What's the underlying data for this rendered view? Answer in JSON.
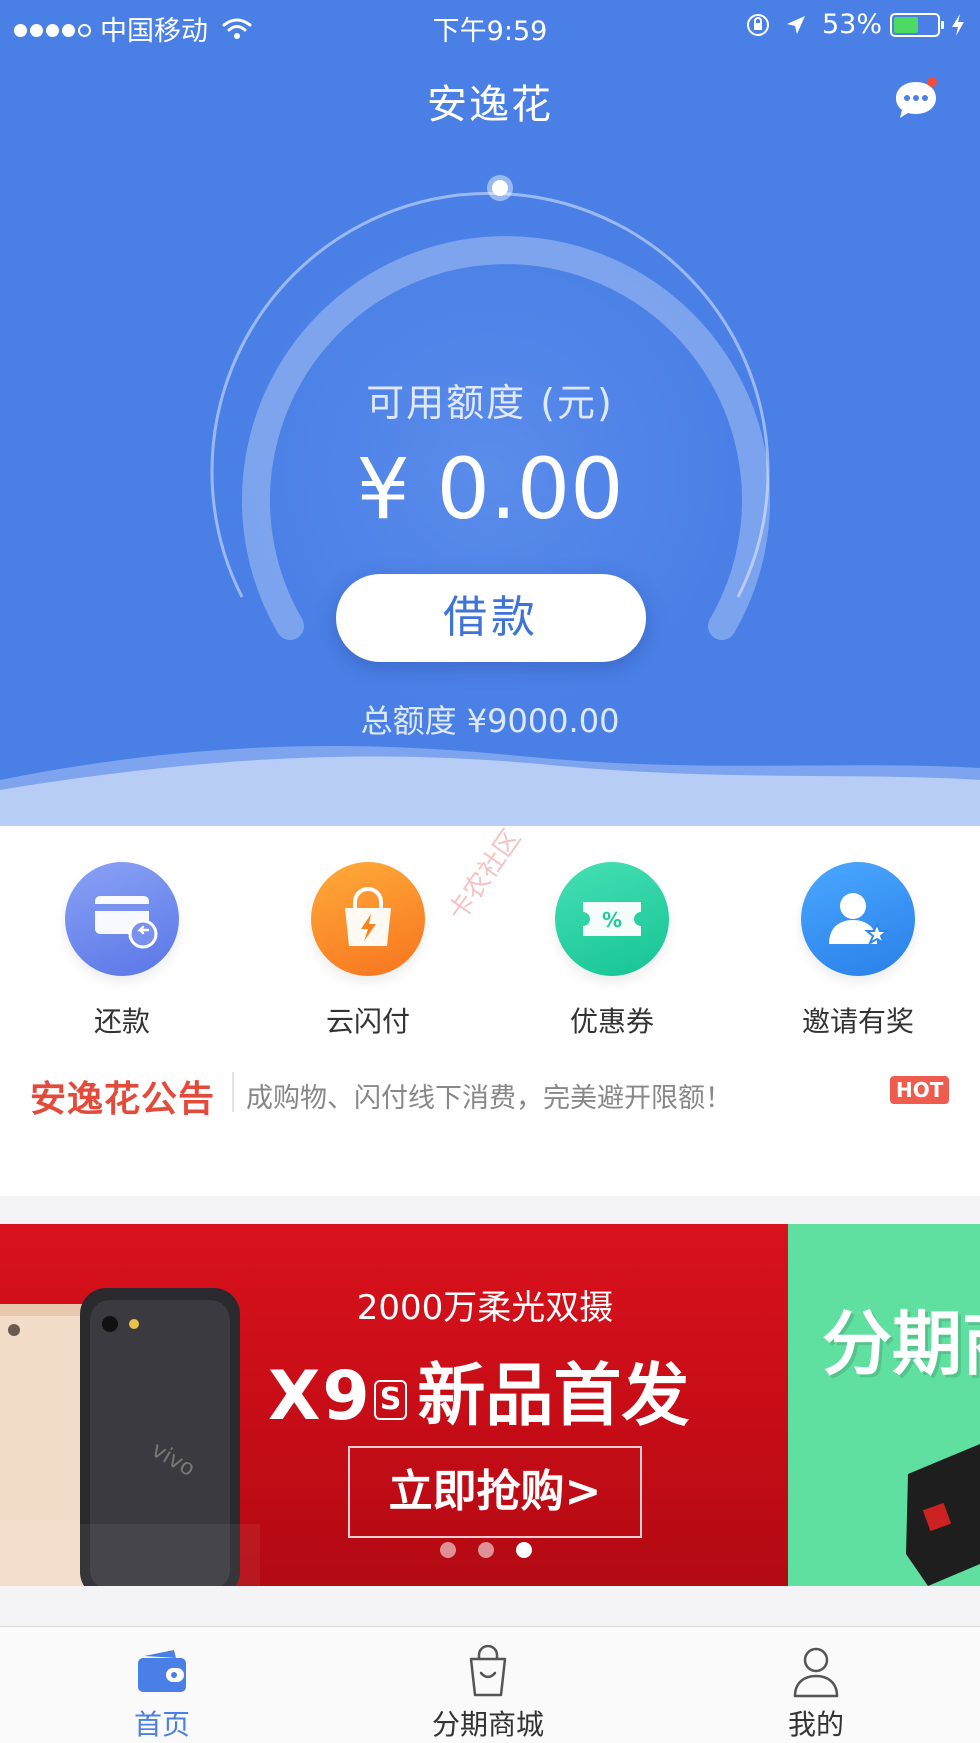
{
  "status_bar": {
    "carrier": "中国移动",
    "time": "下午9:59",
    "battery": "53%"
  },
  "header": {
    "title": "安逸花",
    "message_icon": "chat-bubble-icon"
  },
  "credit": {
    "available_label": "可用额度 (元)",
    "available_amount": "¥ 0.00",
    "loan_button": "借款",
    "total_label": "总额度 ¥9000.00",
    "usage_fraction": 0.0
  },
  "shortcuts": [
    {
      "label": "还款",
      "icon": "repay-card-icon",
      "color": "#6b86ef"
    },
    {
      "label": "云闪付",
      "icon": "shopping-bag-icon",
      "color": "#fb8f2a"
    },
    {
      "label": "优惠券",
      "icon": "coupon-icon",
      "color": "#27d3a2"
    },
    {
      "label": "邀请有奖",
      "icon": "invite-user-icon",
      "color": "#3c93f5"
    }
  ],
  "watermark": "卡农社区",
  "notice": {
    "title": "安逸花公告",
    "text": "成购物、闪付线下消费，完美避开限额！",
    "badge": "HOT"
  },
  "banner": {
    "subtitle": "2000万柔光双摄",
    "model": "X9",
    "model_suffix": "S",
    "headline": "新品首发",
    "cta": "立即抢购>",
    "brand": "vivo",
    "next_slide_text": "分期商",
    "active_dot": 2
  },
  "tabbar": [
    {
      "label": "首页",
      "icon": "wallet-icon",
      "active": true
    },
    {
      "label": "分期商城",
      "icon": "shopping-bag-outline-icon",
      "active": false
    },
    {
      "label": "我的",
      "icon": "person-icon",
      "active": false
    }
  ],
  "colors": {
    "primary": "#4a80e6",
    "notice_red": "#e34a3a",
    "banner_red": "#d9121c",
    "banner_green": "#5fe0a0"
  }
}
